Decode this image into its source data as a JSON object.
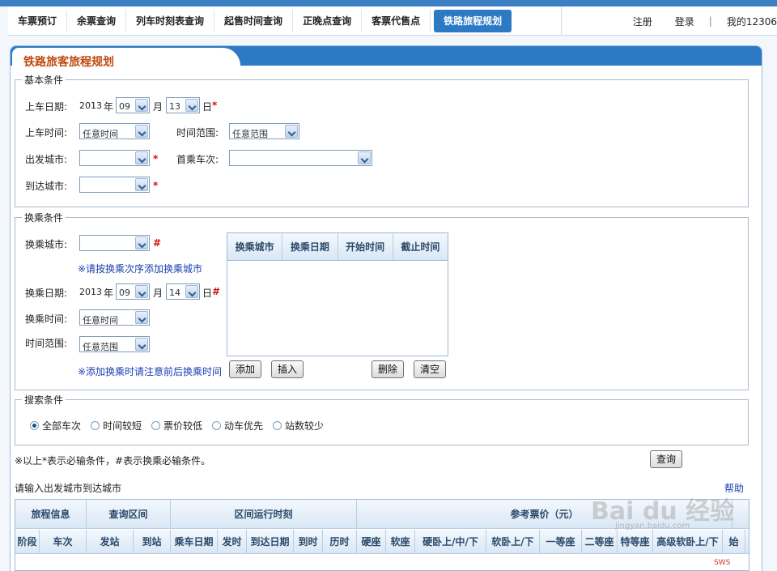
{
  "nav": {
    "items": [
      "车票预订",
      "余票查询",
      "列车时刻表查询",
      "起售时间查询",
      "正晚点查询",
      "客票代售点",
      "铁路旅程规划"
    ],
    "active_index": 6,
    "register": "注册",
    "login": "登录",
    "separator": "|",
    "my12306": "我的12306"
  },
  "panel": {
    "title": "铁路旅客旅程规划"
  },
  "basic": {
    "legend": "基本条件",
    "date_label": "上车日期:",
    "year": "2013",
    "year_unit": "年",
    "month_value": "09",
    "month_unit": "月",
    "day_value": "13",
    "day_unit": "日",
    "req_mark": "*",
    "time_label": "上车时间:",
    "time_value": "任意时间",
    "range_label": "时间范围:",
    "range_value": "任意范围",
    "from_label": "出发城市:",
    "from_value": "",
    "first_train_label": "首乘车次:",
    "first_train_value": "",
    "to_label": "到达城市:",
    "to_value": ""
  },
  "transfer": {
    "legend": "换乘条件",
    "city_label": "换乘城市:",
    "city_value": "",
    "city_mark": "#",
    "hint_order": "※请按换乘次序添加换乘城市",
    "date_label": "换乘日期:",
    "year": "2013",
    "year_unit": "年",
    "month_value": "09",
    "month_unit": "月",
    "day_value": "14",
    "day_unit": "日",
    "date_mark": "#",
    "time_label": "换乘时间:",
    "time_value": "任意时间",
    "range_label": "时间范围:",
    "range_value": "任意范围",
    "hint_time": "※添加换乘时请注意前后换乘时间",
    "grid_headers": [
      "换乘城市",
      "换乘日期",
      "开始时间",
      "截止时间"
    ],
    "buttons": {
      "add": "添加",
      "insert": "插入",
      "delete": "删除",
      "clear": "清空"
    }
  },
  "search": {
    "legend": "搜索条件",
    "options": [
      "全部车次",
      "时间较短",
      "票价较低",
      "动车优先",
      "站数较少"
    ],
    "selected_index": 0
  },
  "footer": {
    "note": "※以上*表示必输条件，#表示换乘必输条件。",
    "query_button": "查询",
    "prompt": "请输入出发城市到达城市",
    "help": "帮助"
  },
  "results": {
    "group_headers": [
      "旅程信息",
      "查询区间",
      "区间运行时刻",
      "参考票价（元）"
    ],
    "columns": [
      "阶段",
      "车次",
      "发站",
      "到站",
      "乘车日期",
      "发时",
      "到达日期",
      "到时",
      "历时",
      "硬座",
      "软座",
      "硬卧上/中/下",
      "软卧上/下",
      "一等座",
      "二等座",
      "特等座",
      "高级软卧上/下",
      "始"
    ]
  },
  "watermark": {
    "brand": "Bai du 经验",
    "sub": "jingyan.baidu.com"
  },
  "corner_badge": "SWS"
}
